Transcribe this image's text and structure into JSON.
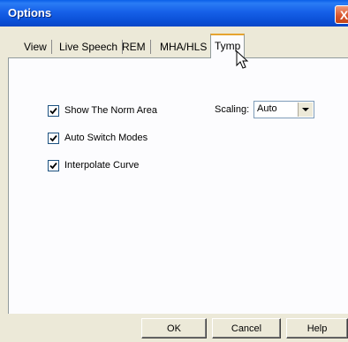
{
  "window": {
    "title": "Options",
    "close_glyph": "X"
  },
  "tabs": [
    {
      "label": "View",
      "active": false
    },
    {
      "label": "Live Speech",
      "active": false
    },
    {
      "label": "REM",
      "active": false
    },
    {
      "label": "MHA/HLS",
      "active": false
    },
    {
      "label": "Tymp",
      "active": true
    }
  ],
  "panel": {
    "checkboxes": [
      {
        "label": "Show The Norm Area",
        "checked": true
      },
      {
        "label": "Auto Switch Modes",
        "checked": true
      },
      {
        "label": "Interpolate Curve",
        "checked": true
      }
    ],
    "scaling": {
      "label": "Scaling:",
      "value": "Auto"
    }
  },
  "buttons": {
    "ok": "OK",
    "cancel": "Cancel",
    "help": "Help"
  },
  "colors": {
    "titlebar": "#0A4FD6",
    "dialog_bg": "#ECE9D8",
    "tab_highlight": "#E6A430"
  }
}
